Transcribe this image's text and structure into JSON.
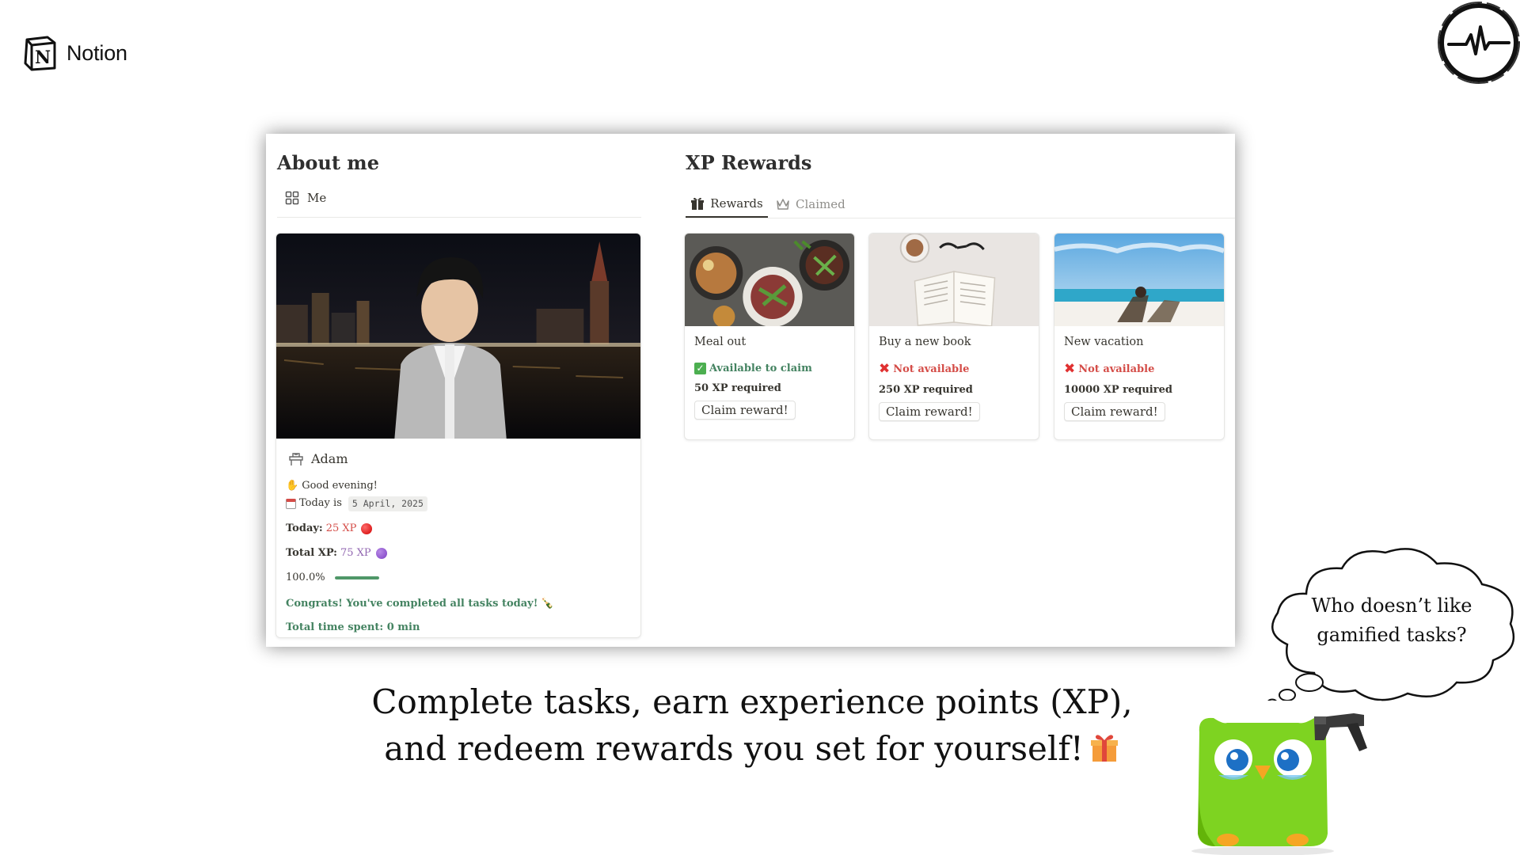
{
  "brand": {
    "logo_text": "Notion"
  },
  "about": {
    "title": "About me",
    "view_tab": "Me",
    "profile": {
      "name": "Adam",
      "greeting": "Good evening!",
      "today_label": "Today is",
      "date": "5 April, 2025",
      "today_xp_label": "Today:",
      "today_xp_value": "25 XP",
      "total_xp_label": "Total XP:",
      "total_xp_value": "75 XP",
      "progress_text": "100.0%",
      "progress_fraction": 1.0,
      "congrats": "Congrats! You've completed all tasks today!",
      "time_spent": "Total time spent: 0 min"
    }
  },
  "rewards": {
    "title": "XP Rewards",
    "tabs": [
      {
        "label": "Rewards",
        "icon": "gift-icon",
        "active": true
      },
      {
        "label": "Claimed",
        "icon": "crown-icon",
        "active": false
      }
    ],
    "cards": [
      {
        "name": "Meal out",
        "status": "Available to claim",
        "available": true,
        "requirement": "50 XP required",
        "button": "Claim reward!",
        "image": "food-photo"
      },
      {
        "name": "Buy a new book",
        "status": "Not available",
        "available": false,
        "requirement": "250 XP required",
        "button": "Claim reward!",
        "image": "book-photo"
      },
      {
        "name": "New vacation",
        "status": "Not available",
        "available": false,
        "requirement": "10000 XP required",
        "button": "Claim reward!",
        "image": "beach-photo"
      }
    ]
  },
  "caption": {
    "line1": "Complete tasks, earn experience points (XP),",
    "line2": "and redeem rewards you set for yourself!"
  },
  "thought_bubble": {
    "line1": "Who doesn’t like",
    "line2": "gamified tasks?"
  },
  "colors": {
    "accent_green": "#448361",
    "accent_red": "#d44c47",
    "accent_purple": "#9065b0",
    "mascot_green": "#7ed321"
  }
}
